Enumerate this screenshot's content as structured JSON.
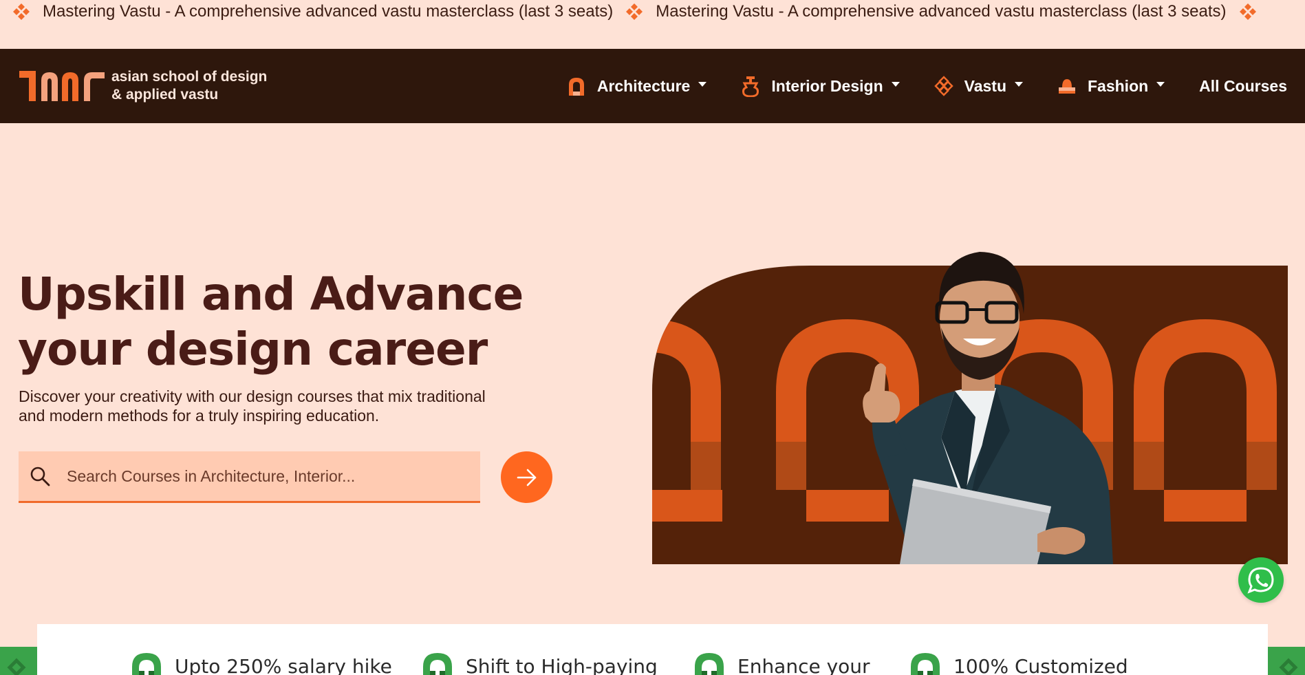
{
  "marquee": {
    "items": [
      "Mastering Vastu - A comprehensive advanced vastu masterclass (last 3 seats)",
      "Mastering Vastu - A comprehensive advanced vastu masterclass (last 3 seats)"
    ],
    "icon": "vastu-diamond-icon"
  },
  "brand": {
    "line1": "asian school of design",
    "line2": "& applied vastu"
  },
  "nav": {
    "architecture": "Architecture",
    "interior": "Interior Design",
    "vastu": "Vastu",
    "fashion": "Fashion",
    "all_courses": "All Courses"
  },
  "hero": {
    "title_line1": "Upskill and Advance",
    "title_line2": "your design career",
    "desc_line1": "Discover your creativity with our design courses that mix traditional",
    "desc_line2": "and modern methods for a truly inspiring education.",
    "search_placeholder": "Search Courses in Architecture, Interior..."
  },
  "benefits": [
    "Upto 250% salary hike",
    "Shift to High-paying",
    "Enhance your",
    "100% Customized"
  ],
  "colors": {
    "page_bg": "#fee2d6",
    "nav_bg": "#2e170c",
    "accent": "#ff671f",
    "hero_art_bg": "#542209",
    "arch_orange": "#d9561a",
    "whatsapp": "#2fbe4a",
    "benefit_green": "#3aa34a"
  }
}
